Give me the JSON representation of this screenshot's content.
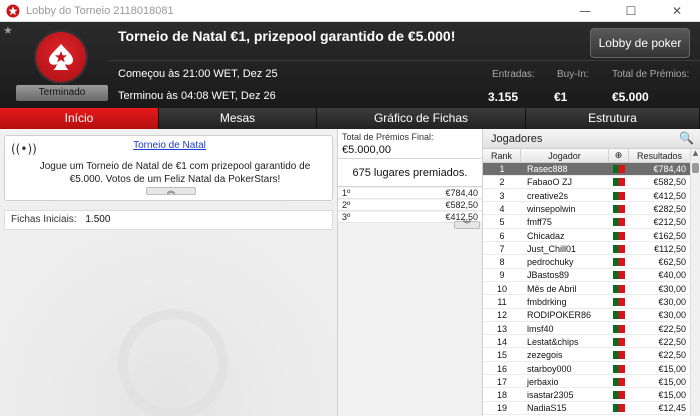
{
  "window": {
    "title": "Lobby do Torneio 2118018081",
    "controls": [
      "—",
      "☐",
      "✕"
    ]
  },
  "header": {
    "title": "Torneio de Natal €1, prizepool garantido de €5.000!",
    "status": "Terminado",
    "lobby_button": "Lobby de poker",
    "start_time": "Começou às 21:00 WET, Dez 25",
    "end_time": "Terminou às 04:08 WET, Dez 26",
    "stats": [
      {
        "label": "Entradas:",
        "value": "3.155"
      },
      {
        "label": "Buy-In:",
        "value": "€1"
      },
      {
        "label": "Total de Prémios:",
        "value": "€5.000"
      }
    ]
  },
  "tabs": [
    {
      "label": "Início",
      "active": true
    },
    {
      "label": "Mesas",
      "active": false
    },
    {
      "label": "Gráfico de Fichas",
      "active": false
    },
    {
      "label": "Estrutura",
      "active": false
    }
  ],
  "announcement": {
    "link": "Torneio de Natal",
    "message": "Jogue um Torneio de Natal de €1 com prizepool garantido de €5.000. Votos de um Feliz Natal da PokerStars!",
    "collapse": "︽"
  },
  "chips": {
    "label": "Fichas Iniciais:",
    "value": "1.500"
  },
  "prizes": {
    "total_label": "Total de Prémios Final:",
    "total_value": "€5.000,00",
    "places": "675 lugares premiados.",
    "rows": [
      {
        "place": "1º",
        "amount": "€784,40"
      },
      {
        "place": "2º",
        "amount": "€582,50"
      },
      {
        "place": "3º",
        "amount": "€412,50"
      }
    ],
    "expand": "︾"
  },
  "players": {
    "title": "Jogadores",
    "columns": {
      "rank": "Rank",
      "player": "Jogador",
      "prize": "Resultados"
    },
    "rows": [
      {
        "rank": "1",
        "name": "Rasec888",
        "prize": "€784,40",
        "selected": true
      },
      {
        "rank": "2",
        "name": "FabaoO ZJ",
        "prize": "€582,50"
      },
      {
        "rank": "3",
        "name": "creative2s",
        "prize": "€412,50"
      },
      {
        "rank": "4",
        "name": "winsepolwin",
        "prize": "€282,50"
      },
      {
        "rank": "5",
        "name": "fmff75",
        "prize": "€212,50"
      },
      {
        "rank": "6",
        "name": "Chicadaz",
        "prize": "€162,50"
      },
      {
        "rank": "7",
        "name": "Just_Chill01",
        "prize": "€112,50"
      },
      {
        "rank": "8",
        "name": "pedrochuky",
        "prize": "€62,50"
      },
      {
        "rank": "9",
        "name": "JBastos89",
        "prize": "€40,00"
      },
      {
        "rank": "10",
        "name": "Mês de Abril",
        "prize": "€30,00"
      },
      {
        "rank": "11",
        "name": "fmbdrking",
        "prize": "€30,00"
      },
      {
        "rank": "12",
        "name": "RODIPOKER86",
        "prize": "€30,00"
      },
      {
        "rank": "13",
        "name": "lmsf40",
        "prize": "€22,50"
      },
      {
        "rank": "14",
        "name": "Lestat&chips",
        "prize": "€22,50"
      },
      {
        "rank": "15",
        "name": "zezegois",
        "prize": "€22,50"
      },
      {
        "rank": "16",
        "name": "starboy000",
        "prize": "€15,00"
      },
      {
        "rank": "17",
        "name": "jerbaxio",
        "prize": "€15,00"
      },
      {
        "rank": "18",
        "name": "isastar2305",
        "prize": "€15,00"
      },
      {
        "rank": "19",
        "name": "NadiaS15",
        "prize": "€12,45"
      }
    ]
  },
  "colors": {
    "accent_red": "#e51a1a",
    "header_dark": "#1a1a1a",
    "selected_row": "#6e6e6e",
    "link_blue": "#1a3fd0"
  }
}
